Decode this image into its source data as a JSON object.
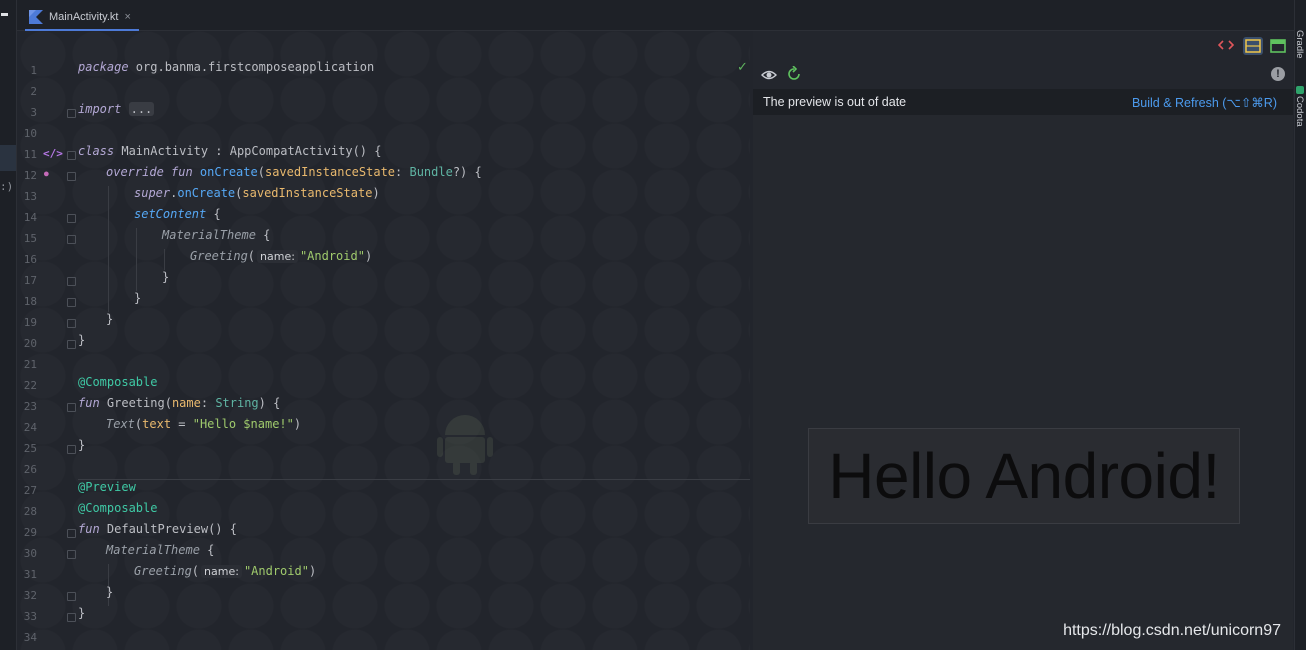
{
  "tab": {
    "file_name": "MainActivity.kt",
    "close": "×"
  },
  "left_strip": {
    "paren": ":)"
  },
  "right_strip": {
    "gradle": "Gradle",
    "codota": "Codota"
  },
  "editor": {
    "line_numbers": [
      "1",
      "2",
      "3",
      "10",
      "11",
      "12",
      "13",
      "14",
      "15",
      "16",
      "17",
      "18",
      "19",
      "20",
      "21",
      "22",
      "23",
      "24",
      "25",
      "26",
      "27",
      "28",
      "29",
      "30",
      "31",
      "32",
      "33",
      "34"
    ],
    "code": {
      "l1_kw": "package",
      "l1_rest": " org.banma.firstcomposeapplication",
      "l3_kw": "import",
      "l3_dots": "...",
      "l11_kw": "class",
      "l11_name": " MainActivity",
      "l11_colon": " : ",
      "l11_super": "AppCompatActivity",
      "l11_end": "() {",
      "l12_kw": "override fun",
      "l12_fn": " onCreate",
      "l12_open": "(",
      "l12_param": "savedInstanceState",
      "l12_colon": ": ",
      "l12_type": "Bundle",
      "l12_end": "?) {",
      "l13_kw": "super",
      "l13_dot": ".",
      "l13_fn": "onCreate",
      "l13_open": "(",
      "l13_arg": "savedInstanceState",
      "l13_end": ")",
      "l14_fn": "setContent",
      "l14_end": " {",
      "l15_fn": "MaterialTheme",
      "l15_end": " {",
      "l16_fn": "Greeting",
      "l16_open": "(",
      "l16_hint": "name:",
      "l16_str": "\"Android\"",
      "l16_end": ")",
      "l17": "}",
      "l18": "}",
      "l19": "}",
      "l20": "}",
      "l22_ann": "@Composable",
      "l23_kw": "fun",
      "l23_fn": " Greeting",
      "l23_open": "(",
      "l23_param": "name",
      "l23_colon": ": ",
      "l23_type": "String",
      "l23_end": ") {",
      "l24_fn": "Text",
      "l24_open": "(",
      "l24_param": "text",
      "l24_eq": " = ",
      "l24_str": "\"Hello $name!\"",
      "l24_end": ")",
      "l25": "}",
      "l27_ann": "@Preview",
      "l28_ann": "@Composable",
      "l29_kw": "fun",
      "l29_fn": " DefaultPreview",
      "l29_end": "() {",
      "l30_fn": "MaterialTheme",
      "l30_end": " {",
      "l31_fn": "Greeting",
      "l31_open": "(",
      "l31_hint": "name:",
      "l31_str": "\"Android\"",
      "l31_end": ")",
      "l32": "}",
      "l33": "}"
    },
    "check_mark": "✓"
  },
  "preview": {
    "banner_message": "The preview is out of date",
    "build_refresh": "Build & Refresh (⌥⇧⌘R)",
    "rendered_text": "Hello Android!",
    "watermark": "https://blog.csdn.net/unicorn97",
    "warning": "!"
  },
  "colors": {
    "accent": "#4d7ad7",
    "link": "#4c9bee",
    "string": "#9fca6c",
    "annotation": "#3fc9a5",
    "keyword": "#cf8e6d"
  }
}
